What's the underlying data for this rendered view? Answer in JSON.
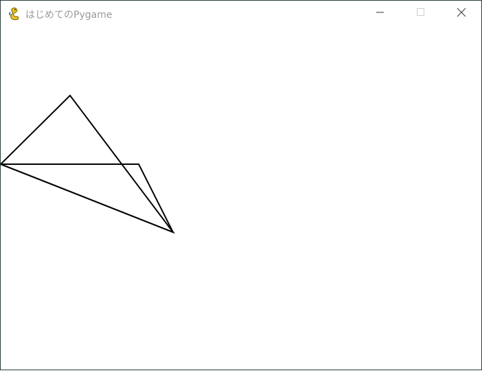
{
  "window": {
    "title": "はじめてのPygame",
    "app_icon": "pygame-snake-icon",
    "controls": [
      "minimize-icon",
      "maximize-icon",
      "close-icon"
    ]
  },
  "canvas": {
    "background": "#ffffff",
    "stroke_color": "#000000",
    "shapes": [
      "triangle-outline",
      "triangle-outline"
    ]
  }
}
